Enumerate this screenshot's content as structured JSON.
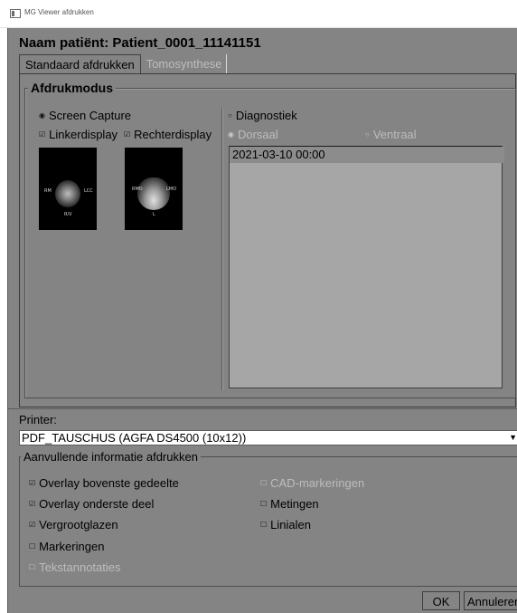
{
  "window": {
    "title": "MG Viewer afdrukken"
  },
  "patient_title": "Naam patiënt: Patient_0001_11141151",
  "tabs": [
    {
      "label": "Standaard afdrukken",
      "active": true
    },
    {
      "label": "Tomosynthese",
      "active": false
    }
  ],
  "print_mode": {
    "legend": "Afdrukmodus",
    "screen_capture": {
      "label": "Screen Capture",
      "selected": true
    },
    "left_display": {
      "label": "Linkerdisplay",
      "checked": true
    },
    "right_display": {
      "label": "Rechterdisplay",
      "checked": true
    },
    "thumbnails": [
      {
        "name": "left-mammogram",
        "labels": [
          "RM",
          "LCC",
          "R/V"
        ]
      },
      {
        "name": "right-mammogram",
        "labels": [
          "RMO",
          "LMO",
          "L"
        ]
      }
    ],
    "diagnostic": {
      "label": "Diagnostiek",
      "selected": false
    },
    "dorsal": {
      "label": "Dorsaal",
      "selected": true,
      "enabled": false
    },
    "ventral": {
      "label": "Ventraal",
      "selected": false,
      "enabled": false
    },
    "studies": [
      "2021-03-10 00:00"
    ]
  },
  "printer": {
    "label": "Printer:",
    "selected": "PDF_TAUSCHUS (AGFA DS4500 (10x12))",
    "arrow": "▼"
  },
  "additional_info": {
    "legend": "Aanvullende informatie afdrukken",
    "options": [
      {
        "label": "Overlay bovenste gedeelte",
        "checked": true,
        "enabled": true
      },
      {
        "label": "Overlay onderste deel",
        "checked": true,
        "enabled": true
      },
      {
        "label": "Vergrootglazen",
        "checked": true,
        "enabled": true
      },
      {
        "label": "Markeringen",
        "checked": false,
        "enabled": true
      },
      {
        "label": "Tekstannotaties",
        "checked": false,
        "enabled": false
      },
      {
        "label": "CAD-markeringen",
        "checked": false,
        "enabled": false
      },
      {
        "label": "Metingen",
        "checked": false,
        "enabled": true
      },
      {
        "label": "Linialen",
        "checked": false,
        "enabled": true
      }
    ]
  },
  "buttons": {
    "ok": "OK",
    "cancel": "Annuleren"
  },
  "glyphs": {
    "radio_on": "◉",
    "radio_off": "○",
    "check_on": "☑",
    "check_off": "☐"
  },
  "colors": {
    "window_bg": "#848484",
    "list_bg": "#a6a6a6",
    "selected_row": "#8c8c8c",
    "disabled_text": "#bdbdbd"
  }
}
